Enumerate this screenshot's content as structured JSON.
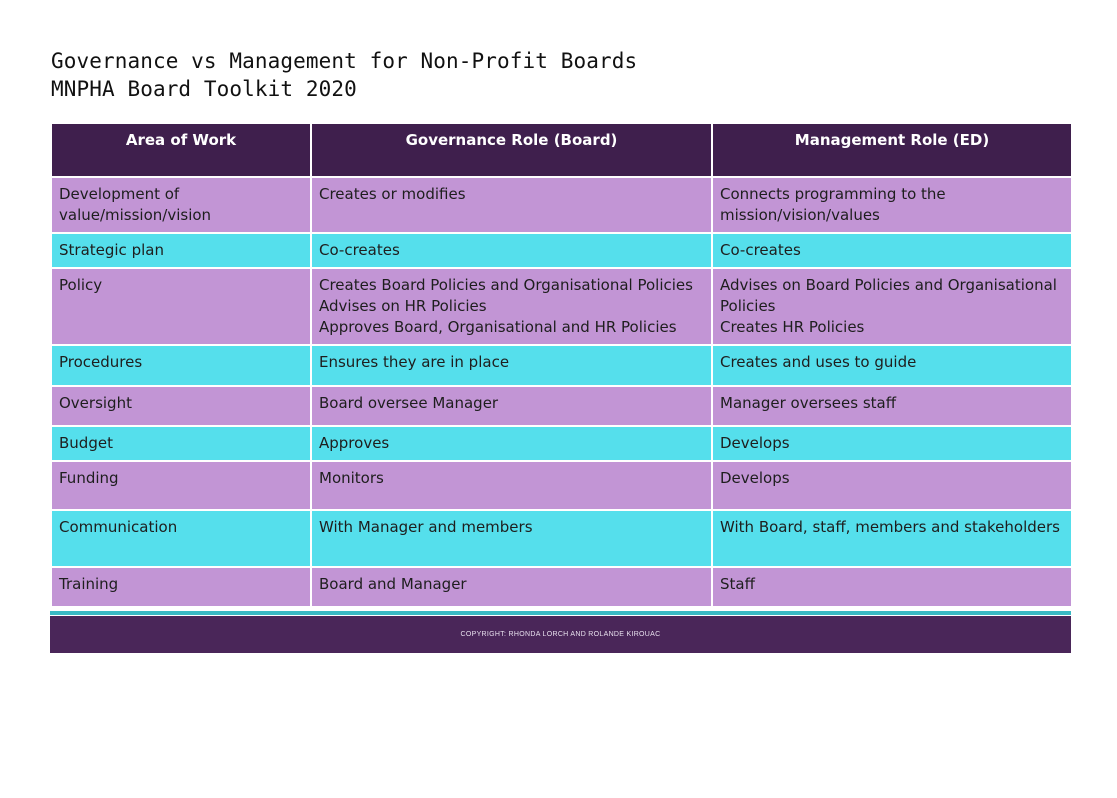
{
  "heading": {
    "title": "Governance vs Management for Non-Profit Boards",
    "subtitle": "MNPHA Board Toolkit 2020"
  },
  "table": {
    "headers": [
      "Area of Work",
      "Governance Role (Board)",
      "Management Role (ED)"
    ],
    "rows": [
      {
        "color": "purple",
        "area": "Development of value/mission/vision",
        "governance": [
          "Creates or modifies"
        ],
        "management": [
          "Connects programming to the mission/vision/values"
        ]
      },
      {
        "color": "cyan",
        "area": "Strategic plan",
        "governance": [
          "Co-creates"
        ],
        "management": [
          "Co-creates"
        ]
      },
      {
        "color": "purple",
        "area": "Policy",
        "governance": [
          "Creates Board Policies and Organisational Policies",
          "Advises on HR Policies",
          "Approves Board, Organisational and HR Policies"
        ],
        "management": [
          "Advises on Board Policies and Organisational Policies",
          "Creates HR Policies"
        ]
      },
      {
        "color": "cyan",
        "area": "Procedures",
        "governance": [
          "Ensures they are in place"
        ],
        "management": [
          "Creates and uses to guide"
        ]
      },
      {
        "color": "purple",
        "area": "Oversight",
        "governance": [
          "Board oversee Manager"
        ],
        "management": [
          "Manager oversees staff"
        ]
      },
      {
        "color": "cyan",
        "area": "Budget",
        "governance": [
          "Approves"
        ],
        "management": [
          "Develops"
        ]
      },
      {
        "color": "purple",
        "area": "Funding",
        "governance": [
          "Monitors"
        ],
        "management": [
          "Develops"
        ]
      },
      {
        "color": "cyan",
        "area": "Communication",
        "governance": [
          "With Manager and members"
        ],
        "management": [
          "With Board, staff, members and stakeholders"
        ]
      },
      {
        "color": "purple",
        "area": "Training",
        "governance": [
          "Board and Manager"
        ],
        "management": [
          "Staff"
        ]
      }
    ]
  },
  "footer": {
    "copyright": "COPYRIGHT: RHONDA LORCH AND ROLANDE KIROUAC"
  },
  "colors": {
    "header_bg": "#3f1f4d",
    "purple_row": "#c295d5",
    "cyan_row": "#55dfec",
    "footer_bg": "#4a2659",
    "footer_accent": "#3ab9c4"
  }
}
